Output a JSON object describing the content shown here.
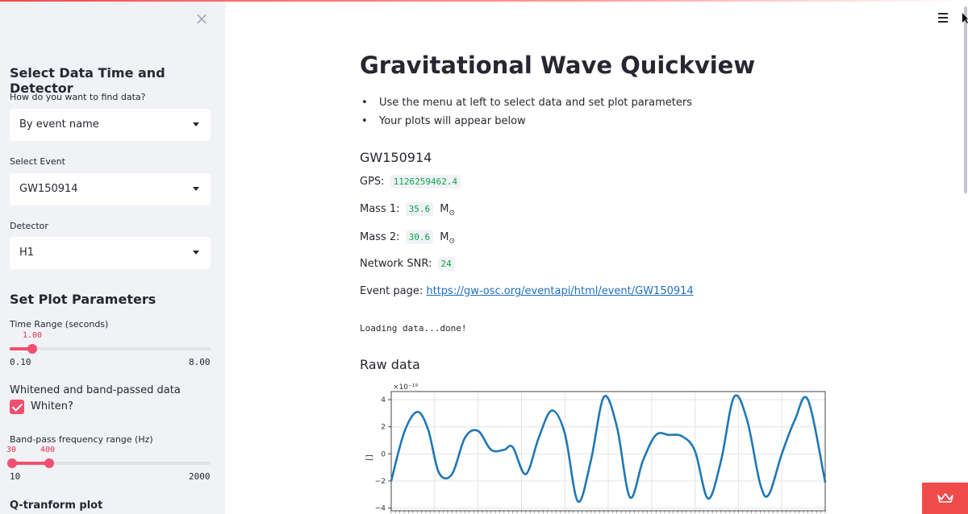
{
  "sidebar": {
    "close_label": "×",
    "section1_title": "Select Data Time and Detector",
    "find_label": "How do you want to find data?",
    "find_value": "By event name",
    "event_label": "Select Event",
    "event_value": "GW150914",
    "detector_label": "Detector",
    "detector_value": "H1",
    "section2_title": "Set Plot Parameters",
    "time_range": {
      "label": "Time Range (seconds)",
      "value": "1.00",
      "min": "0.10",
      "max": "8.00",
      "fraction": 0.114
    },
    "whiten_title": "Whitened and band-passed data",
    "whiten_label": "Whiten?",
    "whiten_checked": true,
    "bandpass": {
      "label": "Band-pass frequency range (Hz)",
      "low": "30",
      "high": "400",
      "min": "10",
      "max": "2000",
      "low_fraction": 0.01,
      "high_fraction": 0.196
    },
    "qtransform_title": "Q-tranform plot"
  },
  "main": {
    "title": "Gravitational Wave Quickview",
    "bullets": [
      "Use the menu at left to select data and set plot parameters",
      "Your plots will appear below"
    ],
    "event_title": "GW150914",
    "gps_label": "GPS:",
    "gps_value": "1126259462.4",
    "mass1_label": "Mass 1:",
    "mass1_value": "35.6",
    "mass2_label": "Mass 2:",
    "mass2_value": "30.6",
    "mass_unit": "M",
    "mass_unit_sub": "⊙",
    "snr_label": "Network SNR:",
    "snr_value": "24",
    "event_page_label": "Event page:",
    "event_page_link": "https://gw-osc.org/eventapi/html/event/GW150914",
    "loading": "Loading data...done!",
    "raw_title": "Raw data"
  },
  "colors": {
    "accent": "#f0506e",
    "sidebar_bg": "#f0f2f6",
    "code_green": "#09a349",
    "link": "#1f6fbf",
    "series": "#1f77b4",
    "badge": "#f04b4b"
  },
  "icons": {
    "close": "close-icon",
    "menu": "hamburger-menu-icon",
    "badge": "crown-icon",
    "select": "chevron-down-icon"
  },
  "chart_data": {
    "type": "line",
    "title": "",
    "xlabel": "",
    "ylabel": "[]",
    "offset_label": "×10⁻¹⁹",
    "yticks": [
      "4",
      "2",
      "0",
      "−2",
      "−4"
    ],
    "ylim": [
      -4.2,
      4.6
    ],
    "xlim": [
      0,
      1
    ],
    "grid": true,
    "series": [
      {
        "x": [
          0,
          0.03,
          0.06,
          0.085,
          0.11,
          0.14,
          0.17,
          0.2,
          0.23,
          0.26,
          0.28,
          0.31,
          0.34,
          0.37,
          0.4,
          0.43,
          0.46,
          0.49,
          0.52,
          0.55,
          0.58,
          0.61,
          0.64,
          0.67,
          0.7,
          0.73,
          0.76,
          0.79,
          0.82,
          0.85,
          0.87,
          0.9,
          0.93,
          0.96,
          1.0
        ],
        "y": [
          -2.0,
          1.6,
          3.1,
          1.8,
          -1.4,
          -1.5,
          1.2,
          1.7,
          0.3,
          0.3,
          0.5,
          -1.5,
          1.2,
          3.2,
          1.5,
          -3.5,
          -0.5,
          4.2,
          2.0,
          -3.2,
          -0.5,
          1.4,
          1.4,
          1.3,
          0.2,
          -3.3,
          -0.5,
          4.2,
          2.5,
          -2.2,
          -3.0,
          0,
          2.5,
          4.0,
          -2.1
        ]
      }
    ]
  }
}
